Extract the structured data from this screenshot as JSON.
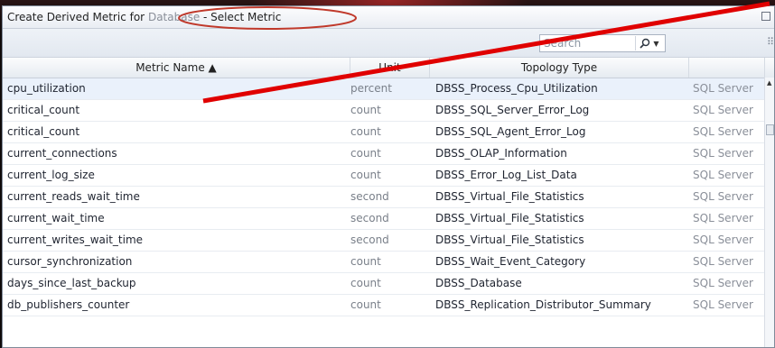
{
  "window": {
    "title_prefix": "Create Derived Metric for",
    "title_db": "Database",
    "title_suffix": " - Select Metric"
  },
  "search": {
    "placeholder": "Search"
  },
  "icons": {
    "search": "magnifier-icon",
    "dropdown": "caret-down-icon",
    "grip": "grip-icon",
    "window_control": "restore-icon"
  },
  "table": {
    "headers": {
      "name": "Metric Name ▲",
      "unit": "Unit",
      "topology": "Topology Type",
      "extra": ""
    },
    "rows": [
      {
        "name": "cpu_utilization",
        "unit": "percent",
        "topology": "DBSS_Process_Cpu_Utilization",
        "extra": "SQL Server"
      },
      {
        "name": "critical_count",
        "unit": "count",
        "topology": "DBSS_SQL_Server_Error_Log",
        "extra": "SQL Server"
      },
      {
        "name": "critical_count",
        "unit": "count",
        "topology": "DBSS_SQL_Agent_Error_Log",
        "extra": "SQL Server"
      },
      {
        "name": "current_connections",
        "unit": "count",
        "topology": "DBSS_OLAP_Information",
        "extra": "SQL Server"
      },
      {
        "name": "current_log_size",
        "unit": "count",
        "topology": "DBSS_Error_Log_List_Data",
        "extra": "SQL Server"
      },
      {
        "name": "current_reads_wait_time",
        "unit": "second",
        "topology": "DBSS_Virtual_File_Statistics",
        "extra": "SQL Server"
      },
      {
        "name": "current_wait_time",
        "unit": "second",
        "topology": "DBSS_Virtual_File_Statistics",
        "extra": "SQL Server"
      },
      {
        "name": "current_writes_wait_time",
        "unit": "second",
        "topology": "DBSS_Virtual_File_Statistics",
        "extra": "SQL Server"
      },
      {
        "name": "cursor_synchronization",
        "unit": "count",
        "topology": "DBSS_Wait_Event_Category",
        "extra": "SQL Server"
      },
      {
        "name": "days_since_last_backup",
        "unit": "count",
        "topology": "DBSS_Database",
        "extra": "SQL Server"
      },
      {
        "name": "db_publishers_counter",
        "unit": "count",
        "topology": "DBSS_Replication_Distributor_Summary",
        "extra": "SQL Server"
      }
    ]
  },
  "colors": {
    "annotation": "#e00000",
    "selected_row": "#eaf1fb"
  }
}
